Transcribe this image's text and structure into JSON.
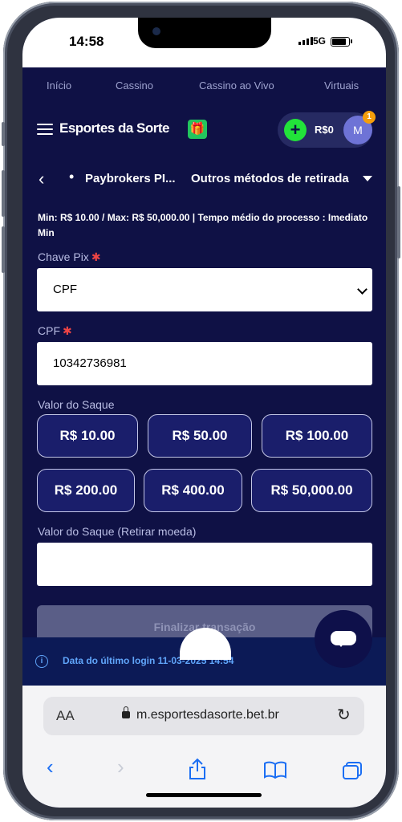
{
  "status": {
    "time": "14:58",
    "network": "5G"
  },
  "topnav": [
    "Início",
    "Cassino",
    "Cassino ao Vivo",
    "Virtuais"
  ],
  "header": {
    "logo": "Esportes da Sorte",
    "balance": "R$0",
    "avatar_initial": "M",
    "notification_count": "1"
  },
  "breadcrumb": {
    "provider": "Paybrokers PI...",
    "methods": "Outros métodos de retirada"
  },
  "limits": "Min: R$ 10.00 / Max: R$ 50,000.00 | Tempo médio do processo : Imediato Min",
  "form": {
    "pix_label": "Chave Pix",
    "pix_value": "CPF",
    "cpf_label": "CPF",
    "cpf_value": "10342736981",
    "amount_label": "Valor do Saque",
    "amounts": [
      "R$ 10.00",
      "R$ 50.00",
      "R$ 100.00",
      "R$ 200.00",
      "R$ 400.00",
      "R$ 50,000.00"
    ],
    "withdraw_label": "Valor do Saque (Retirar moeda)",
    "withdraw_value": "",
    "submit_label": "Finalizar transação"
  },
  "login_info": "Data do último login 11-03-2025 14:54",
  "browser": {
    "aa": "AA",
    "url": "m.esportesdasorte.bet.br"
  },
  "colors": {
    "background": "#0f1145",
    "accent": "#22e33a",
    "button": "#1a1e6b"
  }
}
